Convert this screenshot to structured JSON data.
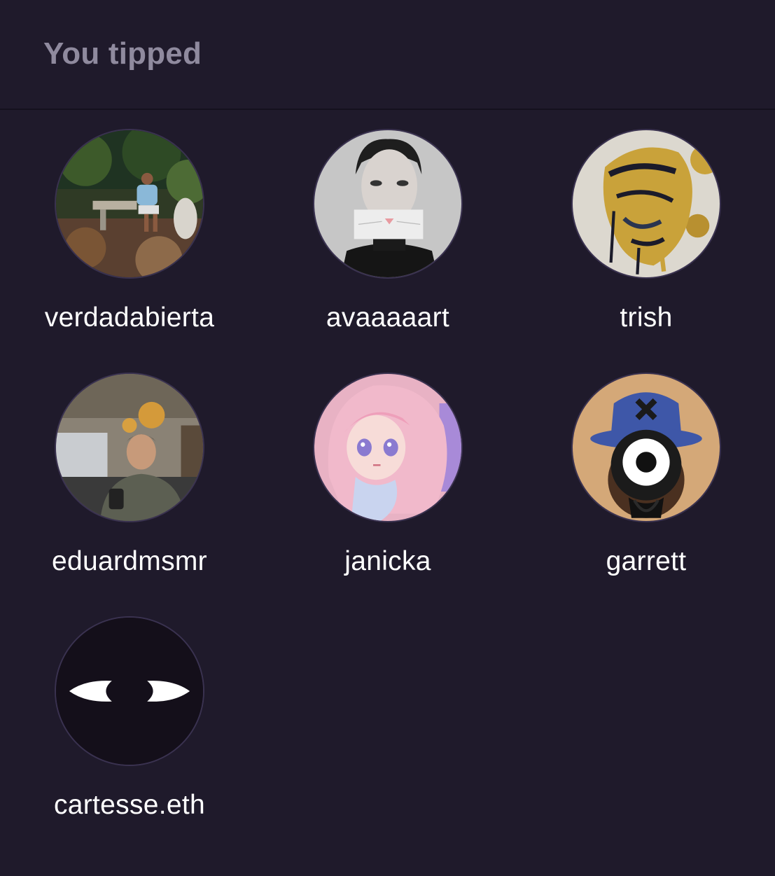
{
  "header": {
    "title": "You tipped"
  },
  "users": [
    {
      "name": "verdadabierta",
      "avatar_icon": "person-in-garden-photo"
    },
    {
      "name": "avaaaaart",
      "avatar_icon": "woman-cat-mouth-collage"
    },
    {
      "name": "trish",
      "avatar_icon": "gold-abstract-face-art"
    },
    {
      "name": "eduardmsmr",
      "avatar_icon": "man-with-phone-photo"
    },
    {
      "name": "janicka",
      "avatar_icon": "anime-girl-pink-hair"
    },
    {
      "name": "garrett",
      "avatar_icon": "one-eyed-character-bucket-hat"
    },
    {
      "name": "cartesse.eth",
      "avatar_icon": "crescent-eyes-logo"
    }
  ]
}
